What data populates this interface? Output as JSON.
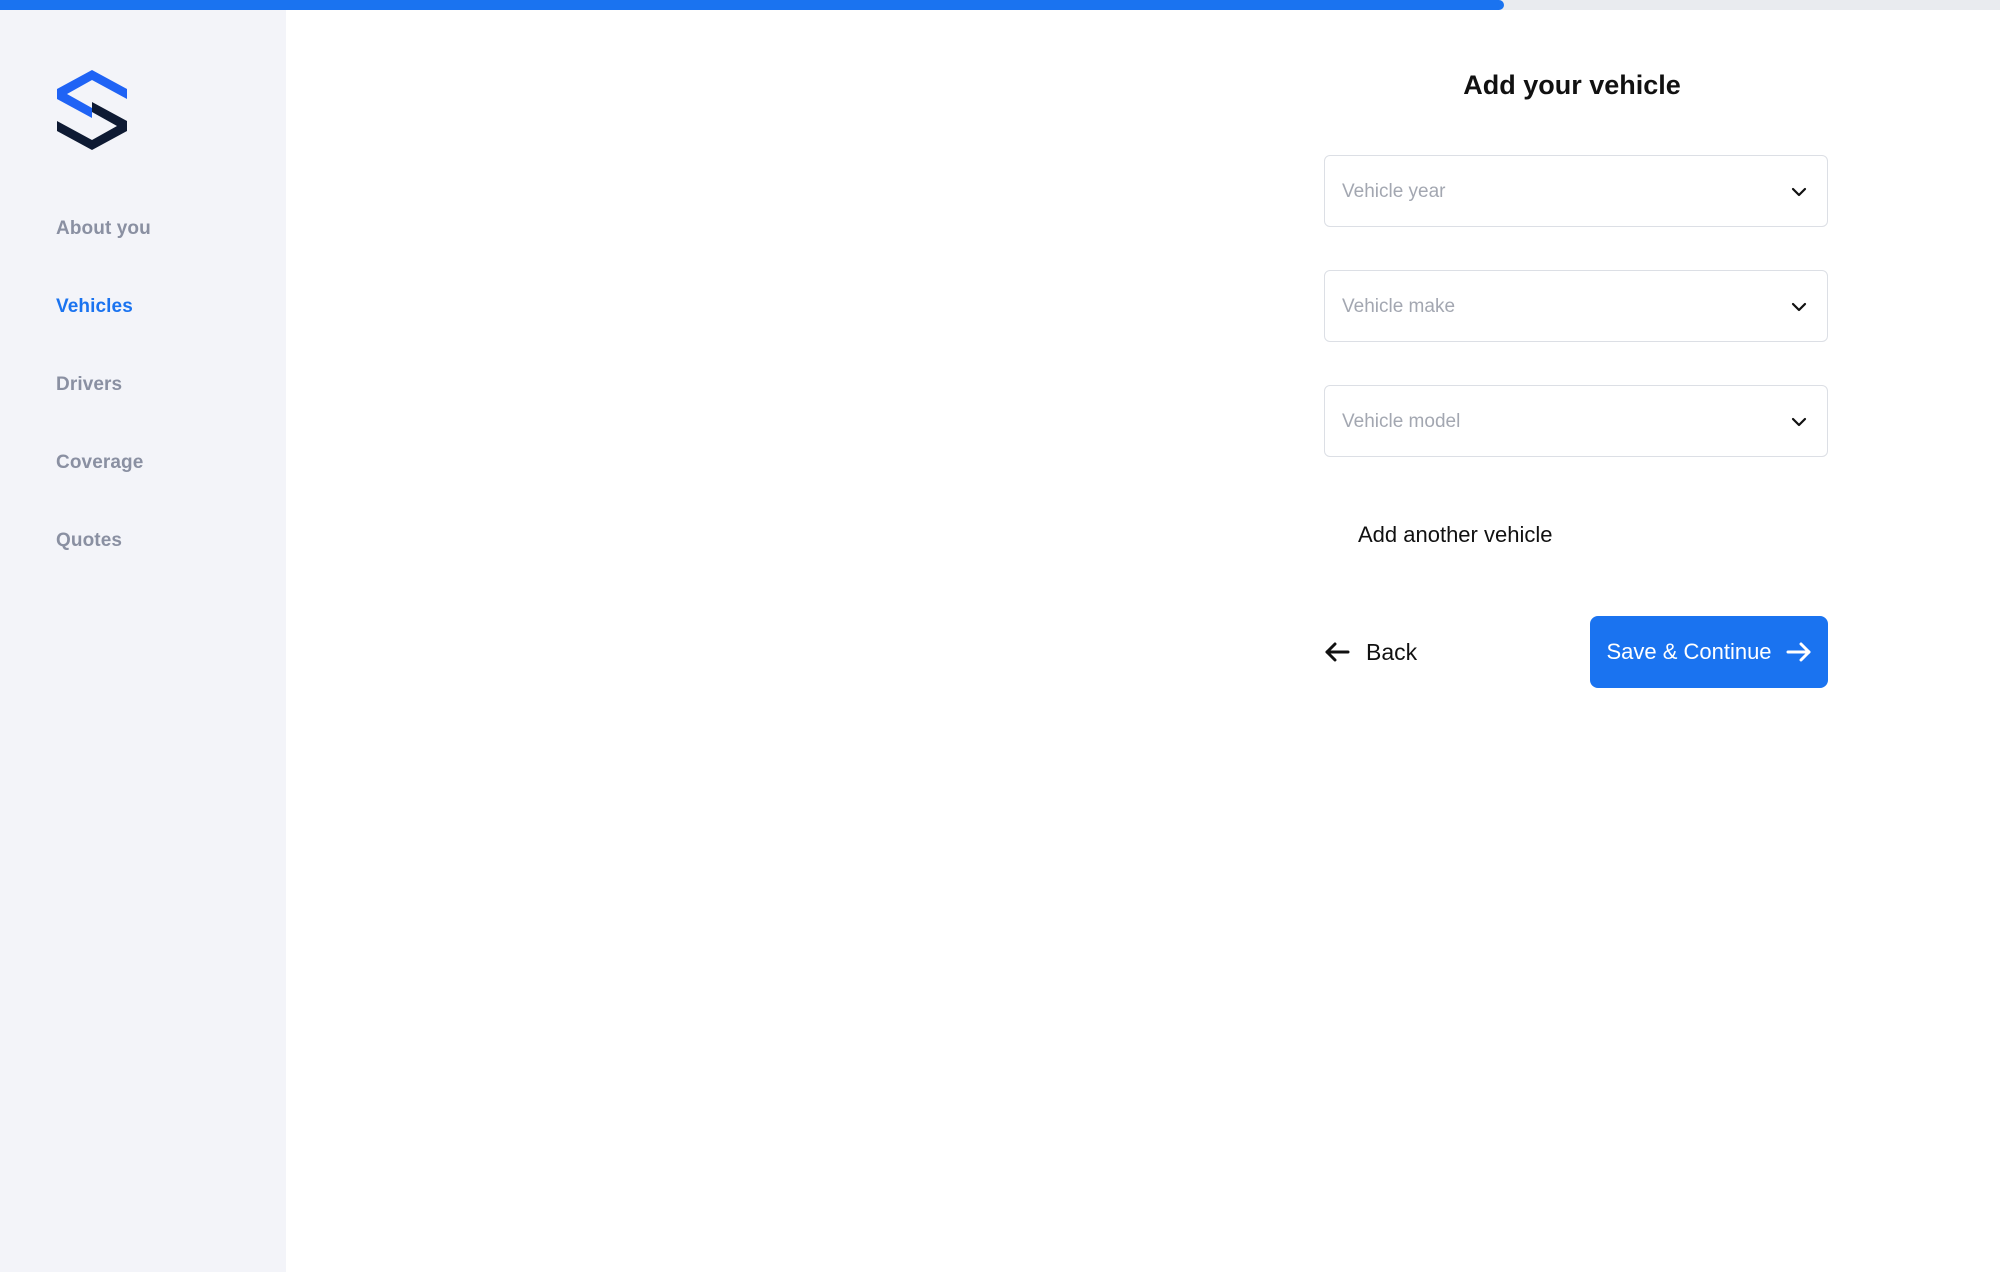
{
  "progress": {
    "fraction": 0.752,
    "fill_color": "#1a73f0"
  },
  "brand": {
    "logo": "hexagon-s-logo",
    "primary_color": "#1a73f0",
    "dark_color": "#0e1a33"
  },
  "sidebar": {
    "items": [
      {
        "label": "About you",
        "active": false
      },
      {
        "label": "Vehicles",
        "active": true
      },
      {
        "label": "Drivers",
        "active": false
      },
      {
        "label": "Coverage",
        "active": false
      },
      {
        "label": "Quotes",
        "active": false
      }
    ]
  },
  "form": {
    "title": "Add your vehicle",
    "fields": [
      {
        "placeholder": "Vehicle year",
        "icon": "chevron-down-icon"
      },
      {
        "placeholder": "Vehicle make",
        "icon": "chevron-down-icon"
      },
      {
        "placeholder": "Vehicle model",
        "icon": "chevron-down-icon"
      }
    ],
    "add_another_label": "Add another vehicle",
    "back_label": "Back",
    "back_icon": "arrow-left-icon",
    "save_label": "Save & Continue",
    "save_icon": "arrow-right-icon"
  }
}
